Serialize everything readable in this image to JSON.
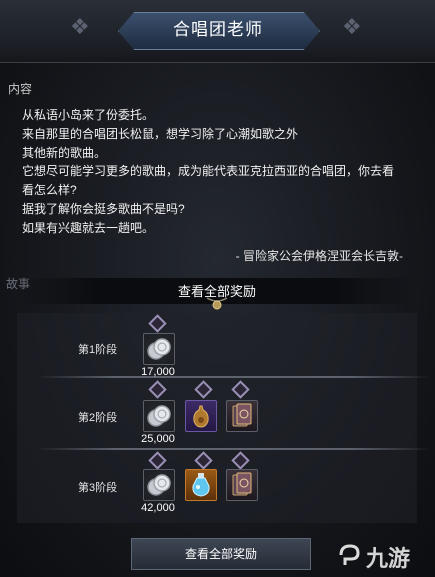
{
  "header": {
    "title": "合唱团老师"
  },
  "content": {
    "section_label": "内容",
    "lines": [
      "从私语小岛来了份委托。",
      "来自那里的合唱团长松鼠，想学习除了心潮如歌之外",
      "其他新的歌曲。",
      "它想尽可能学习更多的歌曲，成为能代表亚克拉西亚的合唱团，你去看",
      "看怎么样?",
      "据我了解你会挺多歌曲不是吗?",
      "如果有兴趣就去一趟吧。"
    ],
    "signature": "- 冒险家公会伊格涅亚会长吉敦-"
  },
  "story": {
    "label": "故事"
  },
  "rewards": {
    "title": "查看全部奖励",
    "stages": [
      {
        "label": "第1阶段",
        "amount": "17,000"
      },
      {
        "label": "第2阶段",
        "amount": "25,000"
      },
      {
        "label": "第3阶段",
        "amount": "42,000"
      }
    ],
    "button": "查看全部奖励"
  },
  "watermark": {
    "text": "九游"
  },
  "colors": {
    "accent": "#3b4f6d",
    "rare": "#3c2a66",
    "epic": "#9a5a14"
  }
}
